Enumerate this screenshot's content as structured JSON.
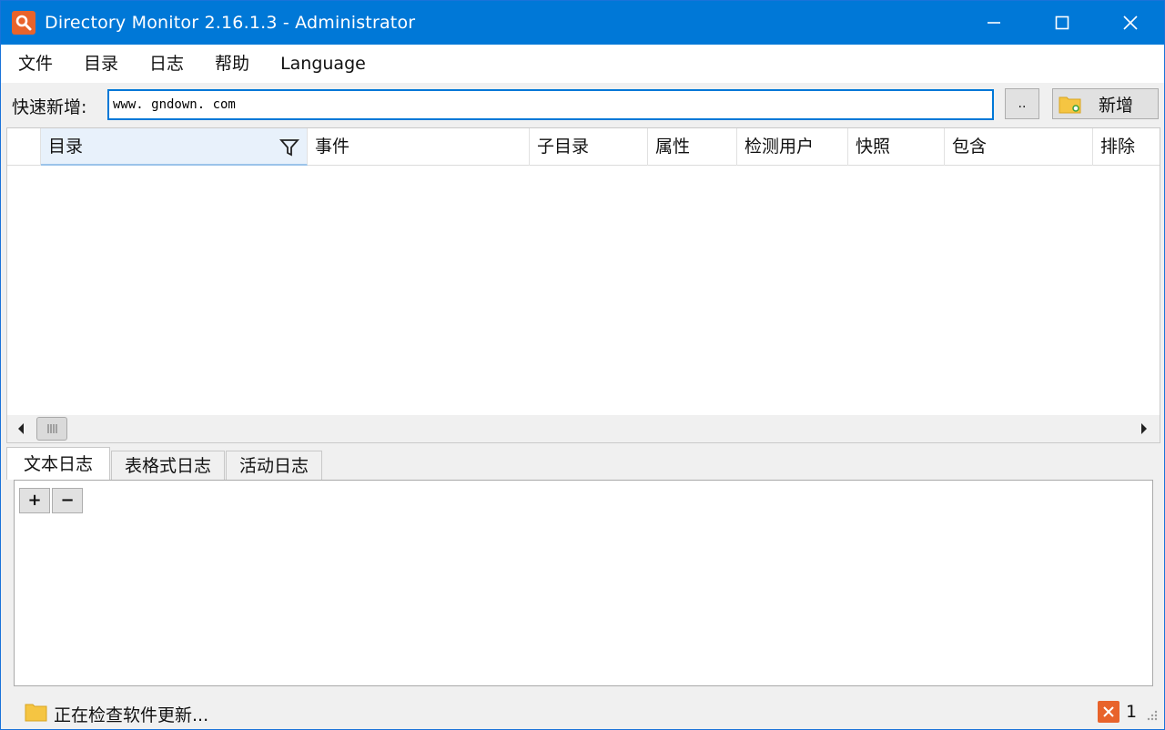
{
  "window": {
    "title": "Directory Monitor 2.16.1.3 - Administrator"
  },
  "menu": {
    "items": [
      "文件",
      "目录",
      "日志",
      "帮助",
      "Language"
    ]
  },
  "quick_add": {
    "label": "快速新增:",
    "input_value": "www. gndown. com",
    "browse_label": "..",
    "add_label": "新增"
  },
  "grid": {
    "columns": [
      "目录",
      "事件",
      "子目录",
      "属性",
      "检测用户",
      "快照",
      "包含",
      "排除"
    ],
    "sort_indicator": "ˆ"
  },
  "log_tabs": [
    "文本日志",
    "表格式日志",
    "活动日志"
  ],
  "log_panel": {
    "add_label": "+",
    "remove_label": "−"
  },
  "status": {
    "text": "正在检查软件更新...",
    "error_count": "1"
  },
  "colors": {
    "titlebar": "#0078d7",
    "accent": "#e8632b",
    "folder": "#f5c542"
  }
}
